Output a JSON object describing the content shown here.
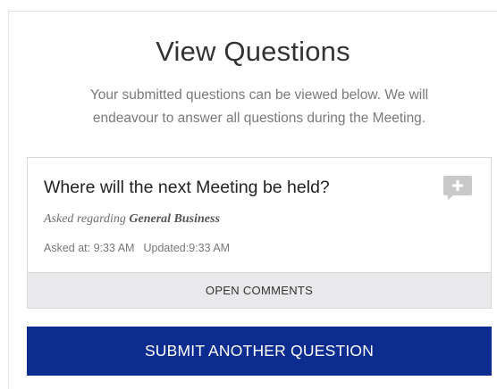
{
  "header": {
    "title": "View Questions",
    "subtitle_line1": "Your submitted questions can be viewed below. We will",
    "subtitle_line2": "endeavour to answer all questions during the Meeting."
  },
  "questions": [
    {
      "text": "Where will the next Meeting be held?",
      "asked_regarding_label": "Asked regarding",
      "topic": "General Business",
      "asked_at_label": "Asked at:",
      "asked_at_value": "9:33 AM",
      "updated_label": "Updated:",
      "updated_value": "9:33 AM",
      "open_comments_label": "OPEN COMMENTS",
      "add_comment_icon": "comment-plus-icon"
    }
  ],
  "actions": {
    "submit_another_label": "SUBMIT ANOTHER QUESTION"
  },
  "colors": {
    "primary_button": "#0c2d8f",
    "card_footer_bg": "#e9e9eb",
    "icon_gray": "#c9c9c9"
  }
}
